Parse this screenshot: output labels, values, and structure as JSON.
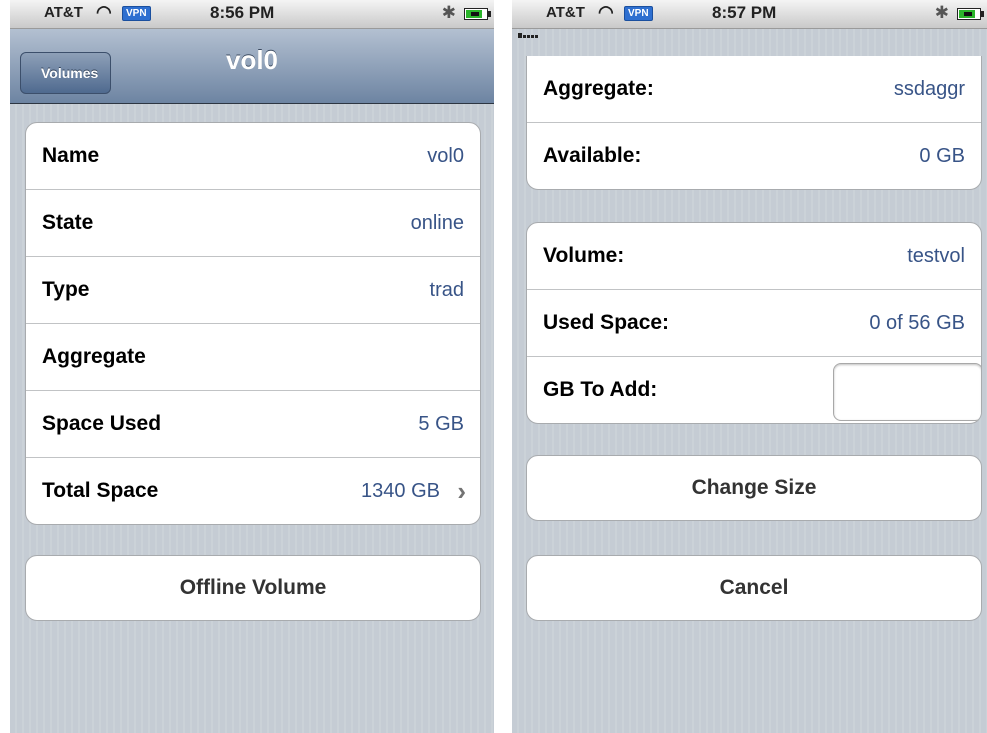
{
  "left": {
    "status": {
      "carrier": "AT&T",
      "vpn": "VPN",
      "time": "8:56 PM"
    },
    "nav": {
      "back_label": "Volumes",
      "title": "vol0"
    },
    "details": [
      {
        "label": "Name",
        "value": "vol0"
      },
      {
        "label": "State",
        "value": "online"
      },
      {
        "label": "Type",
        "value": "trad"
      },
      {
        "label": "Aggregate",
        "value": ""
      },
      {
        "label": "Space Used",
        "value": "5 GB"
      },
      {
        "label": "Total Space",
        "value": "1340 GB"
      }
    ],
    "offline_button": "Offline Volume"
  },
  "right": {
    "status": {
      "carrier": "AT&T",
      "vpn": "VPN",
      "time": "8:57 PM"
    },
    "aggregate_group": [
      {
        "label": "Aggregate:",
        "value": "ssdaggr"
      },
      {
        "label": "Available:",
        "value": "0 GB"
      }
    ],
    "volume_group": [
      {
        "label": "Volume:",
        "value": "testvol"
      },
      {
        "label": "Used Space:",
        "value": "0 of 56 GB"
      }
    ],
    "gb_to_add": {
      "label": "GB To Add:",
      "value": ""
    },
    "change_size_button": "Change Size",
    "cancel_button": "Cancel"
  },
  "icons": [
    "signal-icon",
    "wifi-icon",
    "bluetooth-icon",
    "battery-icon",
    "chevron-right-icon"
  ],
  "colors": {
    "value_text": "#385487",
    "nav_bar": "#6d84a2",
    "background": "#c5ccd4"
  }
}
